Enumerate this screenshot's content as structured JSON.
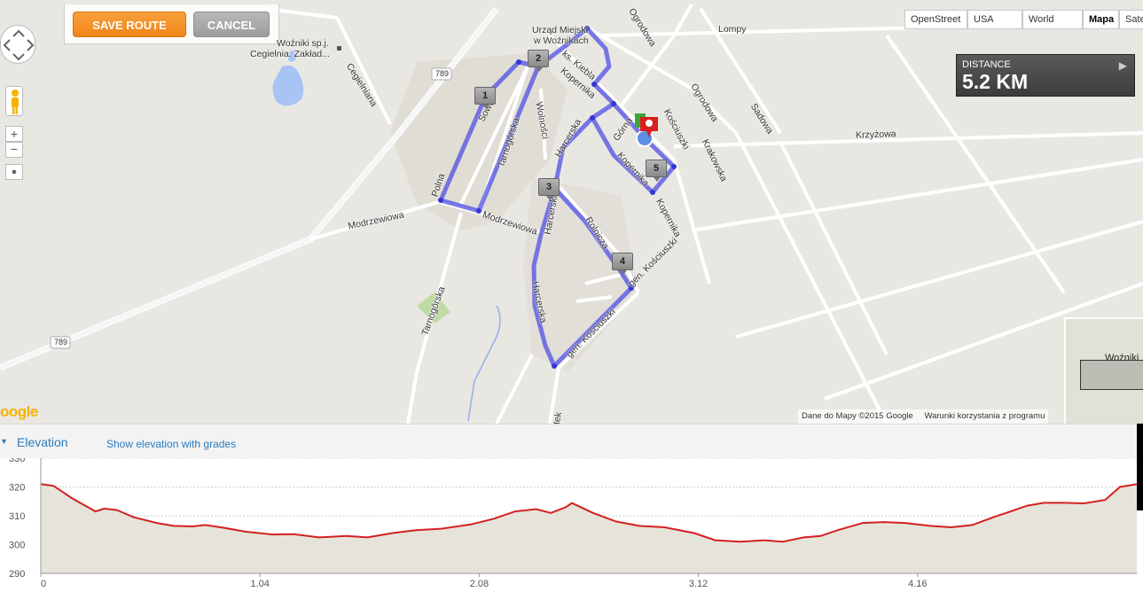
{
  "toolbar": {
    "save_label": "SAVE ROUTE",
    "cancel_label": "CANCEL"
  },
  "map_types": [
    "OpenStreet",
    "USA Topo",
    "World Topo",
    "Mapa",
    "Sate"
  ],
  "active_map_type": "Mapa",
  "distance": {
    "label": "DISTANCE",
    "value": "5.2 KM"
  },
  "map_labels": {
    "poi_top": "Urząd Miejski",
    "poi_top2": "w Woźnikach",
    "company": "Woźniki sp.j.",
    "company2": "Cegielnia. Zakład...",
    "road789a": "789",
    "road789b": "789",
    "lompy": "Lompy",
    "ogrodowa1": "Ogrodowa",
    "ogrodowa2": "Ogrodowa",
    "sadowa": "Sadowa",
    "krzyzowa": "Krzyżowa",
    "krakowska": "Krakowska",
    "kopernika1": "Kopernika",
    "kopernika2": "Kopernika",
    "kopernika3": "Kopernika",
    "kiebla": "ks. Kiebla",
    "wolnosci": "Wolności",
    "cegielniana": "Cegielniana",
    "tarnogorska1": "Tarnogórska",
    "tarnogorska2": "Tarnogórska",
    "modrzewiowa1": "Modrzewiowa",
    "modrzewiowa2": "Modrzewiowa",
    "harcerska1": "Harcerska",
    "harcerska2": "Harcerska",
    "harcerska3": "Harcerska",
    "polna": "Polna",
    "sowia": "Sowia",
    "rolnicza": "Rolnicza",
    "kosciuszki1": "gen. Kościuszki",
    "kosciuszki2": "gen. Kościuszki",
    "kosciuszki3": "Kościuszki",
    "gorna": "Górna",
    "tek": "tek",
    "minimap": "Woźniki"
  },
  "markers": [
    "1",
    "2",
    "3",
    "4",
    "5"
  ],
  "attribution": [
    "Dane do Mapy ©2015 Google",
    "Warunki korzystania z programu"
  ],
  "google_logo": "oogle",
  "elevation": {
    "title": "Elevation",
    "show_grades": "Show elevation with grades"
  },
  "colors": {
    "route": "#4a4ae6",
    "save": "#f39021",
    "cancel": "#a6a6a6",
    "elevation_line": "#d42020",
    "link": "#2a7cbf"
  },
  "chart_data": {
    "type": "area",
    "title": "",
    "xlabel": "",
    "ylabel": "",
    "ylim": [
      290,
      330
    ],
    "xlim": [
      0,
      5.2
    ],
    "yticks": [
      290,
      300,
      310,
      320,
      330
    ],
    "xticks": [
      "0",
      "1.04",
      "2.08",
      "3.12",
      "4.16"
    ],
    "xtick_values": [
      0,
      1.04,
      2.08,
      3.12,
      4.16
    ],
    "grid": true,
    "series": [
      {
        "x": [
          0,
          0.06,
          0.15,
          0.26,
          0.3,
          0.36,
          0.44,
          0.55,
          0.63,
          0.72,
          0.78,
          0.87,
          0.97,
          1.1,
          1.2,
          1.32,
          1.45,
          1.55,
          1.67,
          1.78,
          1.9,
          2.04,
          2.15,
          2.25,
          2.35,
          2.42,
          2.49,
          2.52,
          2.62,
          2.73,
          2.84,
          2.96,
          3.1,
          3.2,
          3.32,
          3.43,
          3.52,
          3.62,
          3.7,
          3.78,
          3.9,
          4.0,
          4.1,
          4.22,
          4.32,
          4.42,
          4.52,
          4.58,
          4.68,
          4.76,
          4.86,
          4.95,
          5.05,
          5.12,
          5.2
        ],
        "y": [
          321,
          320.4,
          316,
          311.5,
          312.5,
          312,
          309.5,
          307.5,
          306.5,
          306.3,
          306.8,
          305.8,
          304.5,
          303.5,
          303.6,
          302.5,
          303,
          302.5,
          304,
          305,
          305.5,
          307,
          309,
          311.5,
          312.3,
          311,
          313,
          314.4,
          311,
          308,
          306.5,
          306,
          304,
          301.5,
          301,
          301.5,
          301,
          302.5,
          303,
          305,
          307.5,
          307.8,
          307.5,
          306.5,
          306,
          306.8,
          309.5,
          311,
          313.5,
          314.5,
          314.5,
          314.3,
          315.5,
          320,
          321
        ]
      }
    ]
  }
}
